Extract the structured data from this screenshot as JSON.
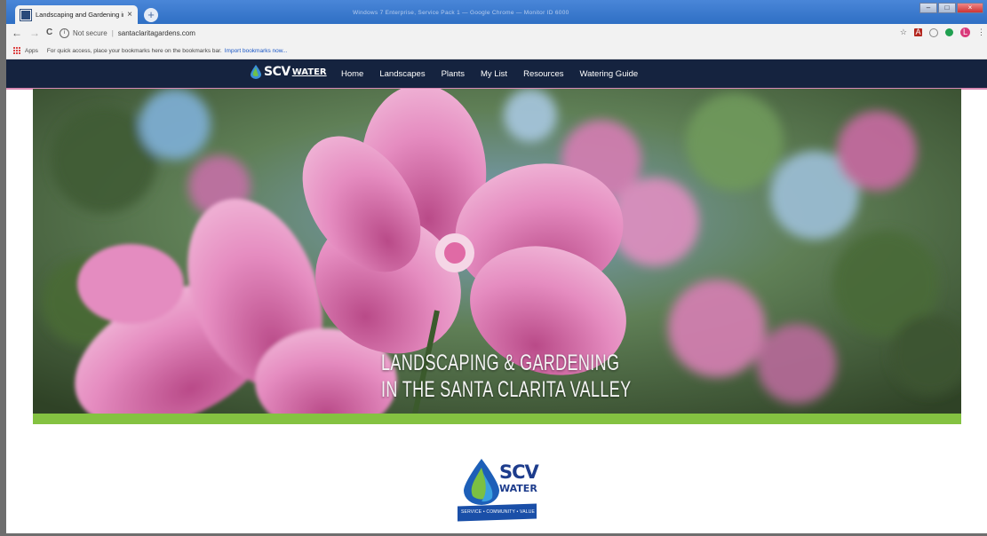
{
  "browser": {
    "tab_title": "Landscaping and Gardening in t",
    "tab_close": "×",
    "new_tab": "+",
    "window_title_blurred": "Windows 7 Enterprise, Service Pack 1 — Google Chrome — Monitor ID 6000",
    "back": "←",
    "forward": "→",
    "reload": "C",
    "security_label": "Not secure",
    "url": "santaclaritagardens.com",
    "bookmark_star": "☆",
    "profile_initial": "L",
    "menu": "⋮"
  },
  "bookmarks_bar": {
    "apps_label": "Apps",
    "hint": "For quick access, place your bookmarks here on the bookmarks bar.",
    "import_link": "Import bookmarks now..."
  },
  "site": {
    "logo_primary": "SCV",
    "logo_secondary": "WATER",
    "nav": [
      "Home",
      "Landscapes",
      "Plants",
      "My List",
      "Resources",
      "Watering Guide"
    ],
    "hero_title_line1": "LANDSCAPING & GARDENING",
    "hero_title_line2": "IN THE SANTA CLARITA VALLEY",
    "footer_logo_primary": "SCV",
    "footer_logo_secondary": "WATER",
    "footer_logo_tagline": "SERVICE • COMMUNITY • VALUE"
  },
  "colors": {
    "nav_bg": "#15233f",
    "hero_accent_bar": "#84c241",
    "logo_blue": "#1d3c8c"
  }
}
